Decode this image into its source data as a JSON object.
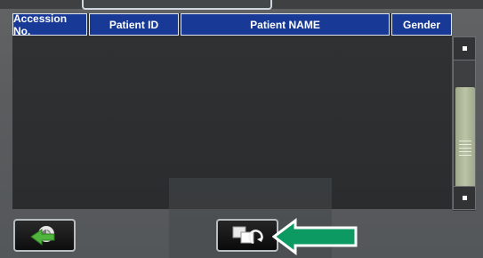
{
  "table": {
    "columns": [
      "Accession No.",
      "Patient ID",
      "Patient NAME",
      "Gender"
    ],
    "rows": []
  },
  "icons": {
    "back_button": "back-arrow-icon",
    "swap_button": "refresh-swap-icon",
    "callout": "green-arrow-icon",
    "scroll_up": "scroll-up-icon",
    "scroll_down": "scroll-down-icon"
  },
  "colors": {
    "header_bg": "#183a96",
    "header_border": "#dfe6f2",
    "table_bg": "#2d2f31",
    "screen_bg": "#5a5c5e",
    "scroll_thumb": "#bcc4a6",
    "arrow_green": "#0c9a62",
    "back_icon_green": "#4fb53c"
  }
}
